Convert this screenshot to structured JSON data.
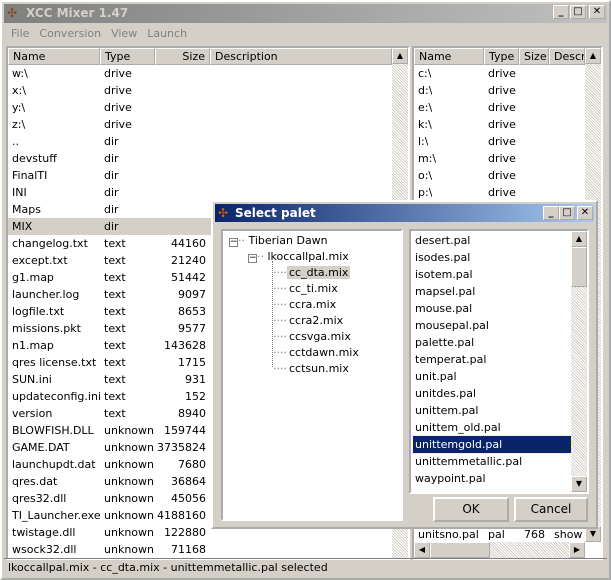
{
  "window": {
    "title": "XCC Mixer 1.47",
    "minimize": "_",
    "maximize": "□",
    "close": "✕"
  },
  "menu": [
    "File",
    "Conversion",
    "View",
    "Launch"
  ],
  "left": {
    "headers": [
      "Name",
      "Type",
      "Size",
      "Description"
    ],
    "rows": [
      [
        "w:\\",
        "drive",
        ""
      ],
      [
        "x:\\",
        "drive",
        ""
      ],
      [
        "y:\\",
        "drive",
        ""
      ],
      [
        "z:\\",
        "drive",
        ""
      ],
      [
        "..",
        "dir",
        ""
      ],
      [
        "devstuff",
        "dir",
        ""
      ],
      [
        "FinalTI",
        "dir",
        ""
      ],
      [
        "INI",
        "dir",
        ""
      ],
      [
        "Maps",
        "dir",
        ""
      ],
      [
        "MIX",
        "dir",
        ""
      ],
      [
        "changelog.txt",
        "text",
        "44160"
      ],
      [
        "except.txt",
        "text",
        "21240"
      ],
      [
        "g1.map",
        "text",
        "51442"
      ],
      [
        "launcher.log",
        "text",
        "9097"
      ],
      [
        "logfile.txt",
        "text",
        "8653"
      ],
      [
        "missions.pkt",
        "text",
        "9577"
      ],
      [
        "n1.map",
        "text",
        "143628"
      ],
      [
        "qres license.txt",
        "text",
        "1715"
      ],
      [
        "SUN.ini",
        "text",
        "931"
      ],
      [
        "updateconfig.ini",
        "text",
        "152"
      ],
      [
        "version",
        "text",
        "8940"
      ],
      [
        "BLOWFISH.DLL",
        "unknown",
        "159744"
      ],
      [
        "GAME.DAT",
        "unknown",
        "3735824"
      ],
      [
        "launchupdt.dat",
        "unknown",
        "7680"
      ],
      [
        "qres.dat",
        "unknown",
        "36864"
      ],
      [
        "qres32.dll",
        "unknown",
        "45056"
      ],
      [
        "TI_Launcher.exe",
        "unknown",
        "4188160"
      ],
      [
        "twistage.dll",
        "unknown",
        "122880"
      ],
      [
        "wsock32.dll",
        "unknown",
        "71168"
      ]
    ],
    "selected_index": 9
  },
  "right": {
    "headers": [
      "Name",
      "Type",
      "Size",
      "Descr"
    ],
    "rows": [
      [
        "c:\\",
        "drive"
      ],
      [
        "d:\\",
        "drive"
      ],
      [
        "e:\\",
        "drive"
      ],
      [
        "k:\\",
        "drive"
      ],
      [
        "l:\\",
        "drive"
      ],
      [
        "m:\\",
        "drive"
      ],
      [
        "o:\\",
        "drive"
      ],
      [
        "p:\\",
        "drive"
      ]
    ],
    "last_row": [
      "unitsno.pal",
      "pal",
      "768",
      "show"
    ]
  },
  "dialog": {
    "title": "Select palet",
    "tree": {
      "root": "Tiberian Dawn",
      "child": "lkoccallpal.mix",
      "items": [
        "cc_dta.mix",
        "cc_ti.mix",
        "ccra.mix",
        "ccra2.mix",
        "ccsvga.mix",
        "cctdawn.mix",
        "cctsun.mix"
      ],
      "selected": "cc_dta.mix"
    },
    "palettes": [
      "desert.pal",
      "isodes.pal",
      "isotem.pal",
      "mapsel.pal",
      "mouse.pal",
      "mousepal.pal",
      "palette.pal",
      "temperat.pal",
      "unit.pal",
      "unitdes.pal",
      "unittem.pal",
      "unittem_old.pal",
      "unittemgold.pal",
      "unittemmetallic.pal",
      "waypoint.pal"
    ],
    "selected_palette": "unittemgold.pal",
    "ok": "OK",
    "cancel": "Cancel"
  },
  "status": "lkoccallpal.mix - cc_dta.mix - unittemmetallic.pal selected"
}
